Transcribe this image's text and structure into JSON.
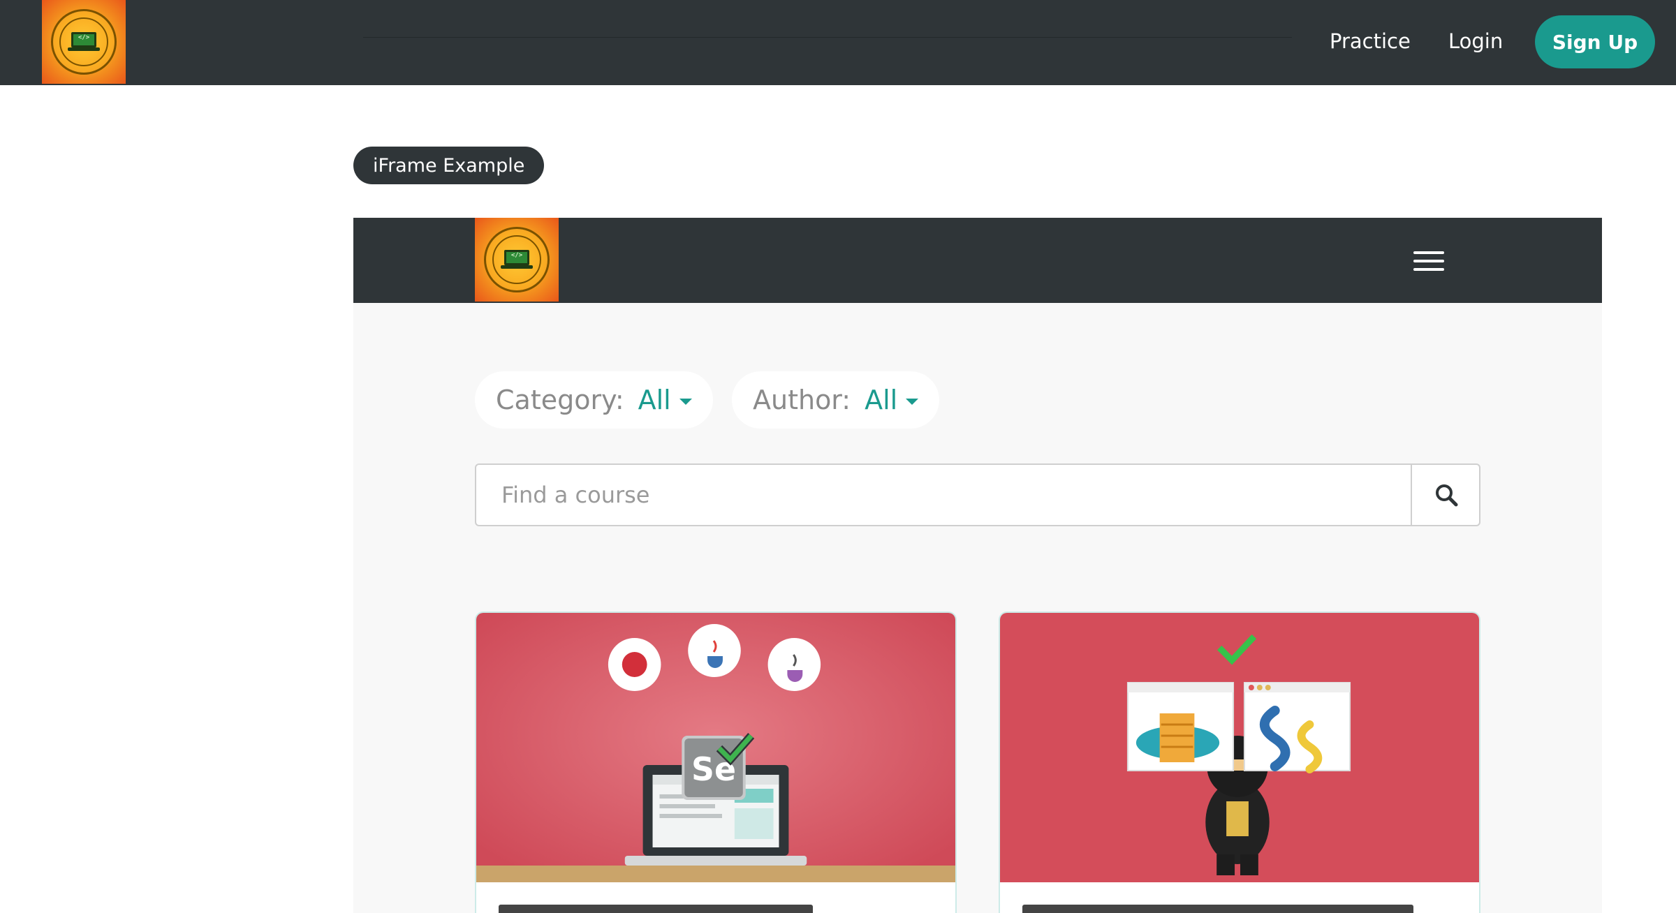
{
  "header": {
    "logo_alt": "Let's Kode It - Anyone Can Code",
    "nav": [
      {
        "label": "Practice"
      },
      {
        "label": "Login"
      }
    ],
    "signup_label": "Sign Up"
  },
  "section": {
    "pill_label": "iFrame Example"
  },
  "iframe": {
    "filters": [
      {
        "label": "Category:",
        "value": "All"
      },
      {
        "label": "Author:",
        "value": "All"
      }
    ],
    "search": {
      "placeholder": "Find a course"
    },
    "cards": [
      {
        "thumb": "selenium-java-course-illustration",
        "title_visible": ""
      },
      {
        "thumb": "selenium-python-course-illustration",
        "title_visible": ""
      }
    ]
  },
  "colors": {
    "nav_bg": "#2f3538",
    "accent": "#1a9a8e",
    "card_red": "#d4515e",
    "iframe_bg": "#f8f8f8"
  }
}
